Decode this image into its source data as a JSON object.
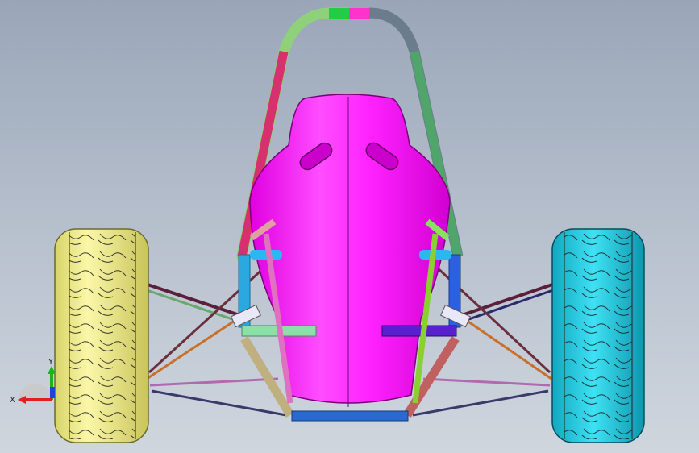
{
  "viewport": {
    "background_top": "#9aa6b8",
    "background_bottom": "#cfd6de"
  },
  "model": {
    "seat_color": "#ff00ff",
    "left_wheel_color": "#f4f08a",
    "right_wheel_color": "#27c9e0",
    "roll_hoop_colors": [
      "#8fd17a",
      "#22cc44",
      "#ff33cc",
      "#6b7c8c"
    ],
    "icons": [
      "seat-icon",
      "wheel-icon",
      "roll-hoop-icon",
      "suspension-arm-icon"
    ]
  },
  "triad": {
    "x_label": "X",
    "y_label": "Y",
    "x_color": "#e02020",
    "y_color": "#20b020",
    "z_color": "#2040e0"
  }
}
